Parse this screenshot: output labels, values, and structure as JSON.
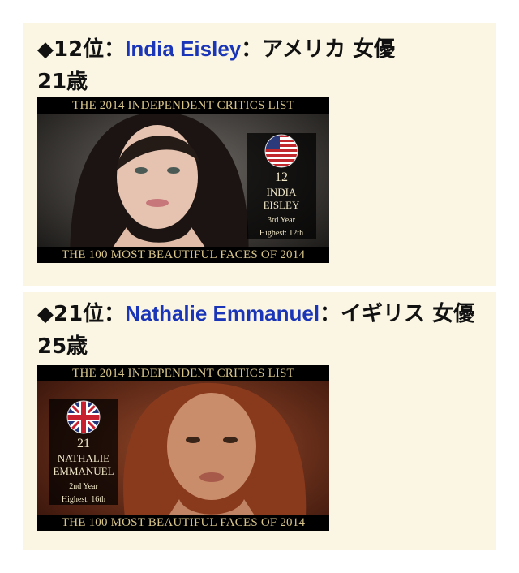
{
  "entries": [
    {
      "rank_label": "◆12位：",
      "name": "India Eisley",
      "suffix": "：アメリカ 女優",
      "age_line": "21歳",
      "banner_top": "THE 2014 INDEPENDENT CRITICS LIST",
      "banner_bottom": "THE 100 MOST BEAUTIFUL FACES OF 2014",
      "badge": {
        "rank": "12",
        "name_line1": "INDIA",
        "name_line2": "EISLEY",
        "year": "3rd Year",
        "highest": "Highest: 12th",
        "flag": "us-flag-icon"
      }
    },
    {
      "rank_label": "◆21位：",
      "name": "Nathalie Emmanuel",
      "suffix": "：イギリス 女優",
      "age_line": "25歳",
      "banner_top": "THE 2014 INDEPENDENT CRITICS LIST",
      "banner_bottom": "THE 100 MOST BEAUTIFUL FACES OF 2014",
      "badge": {
        "rank": "21",
        "name_line1": "NATHALIE",
        "name_line2": "EMMANUEL",
        "year": "2nd Year",
        "highest": "Highest: 16th",
        "flag": "uk-flag-icon"
      }
    }
  ],
  "colors": {
    "card_background": "#fbf6e3",
    "link": "#1a35b8",
    "banner_text": "#d7c48a"
  }
}
